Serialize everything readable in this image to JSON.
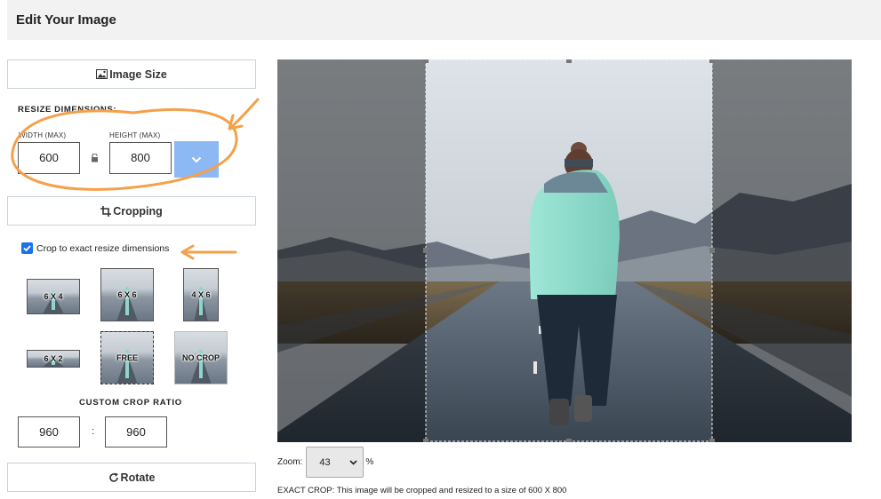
{
  "header": {
    "title": "Edit Your Image"
  },
  "sections": {
    "image_size": "Image Size",
    "cropping": "Cropping",
    "rotate": "Rotate"
  },
  "resize": {
    "heading": "RESIZE DIMENSIONS:",
    "width_label": "WIDTH (MAX)",
    "width_value": "600",
    "height_label": "HEIGHT (MAX)",
    "height_value": "800",
    "lock_icon": "lock-icon",
    "dropdown_icon": "chevron-down-icon"
  },
  "crop": {
    "checkbox_label": "Crop to exact resize dimensions",
    "checked": true,
    "presets": [
      {
        "label": "6 X 4"
      },
      {
        "label": "6 X 6"
      },
      {
        "label": "4 X 6"
      },
      {
        "label": "6 X 2"
      },
      {
        "label": "FREE"
      },
      {
        "label": "NO CROP"
      }
    ],
    "custom_heading": "CUSTOM CROP RATIO",
    "ratio_w": "960",
    "ratio_sep": ":",
    "ratio_h": "960"
  },
  "preview": {
    "zoom_label": "Zoom:",
    "zoom_value": "43",
    "zoom_unit": "%",
    "caption": "EXACT CROP: This image will be cropped and resized to a size of 600 X 800"
  },
  "colors": {
    "accent": "#8cb8f4",
    "annotation": "#f5a04a",
    "checkbox": "#1a73e8"
  }
}
